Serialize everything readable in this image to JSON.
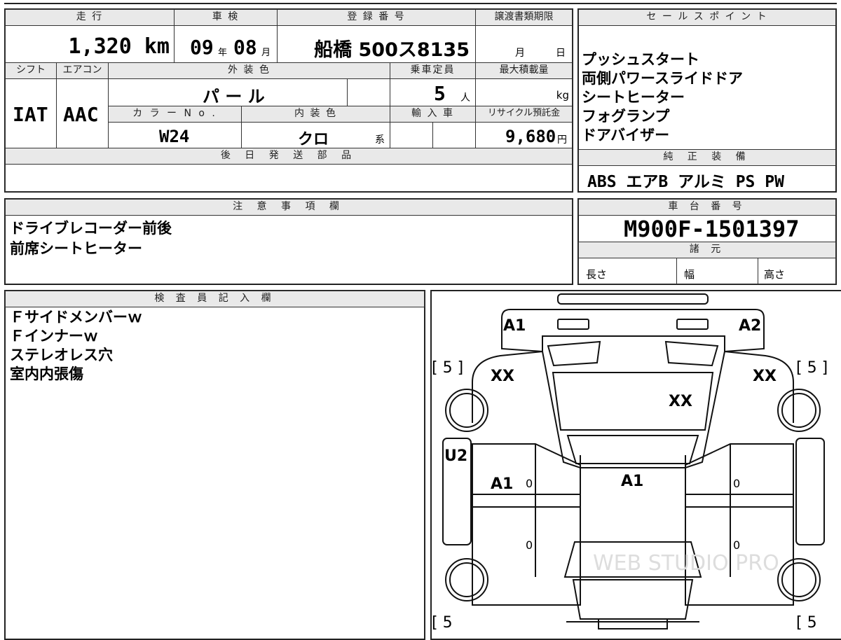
{
  "header": {
    "mileage_label": "走 行",
    "inspection_label": "車 検",
    "registration_label": "登 録 番 号",
    "transfer_deadline_label": "譲渡書類期限",
    "sales_points_label": "セ ー ル ス ポ イ ン ト"
  },
  "vehicle": {
    "mileage": "1,320 km",
    "inspection_year": "09",
    "year_unit": "年",
    "inspection_month": "08",
    "month_unit": "月",
    "registration": "船橋 500ス8135",
    "deadline_month_unit": "月",
    "deadline_day_unit": "日"
  },
  "row2": {
    "shift_label": "シフト",
    "aircon_label": "エアコン",
    "exterior_label": "外 装 色",
    "capacity_label": "乗車定員",
    "max_load_label": "最大積載量",
    "shift": "IAT",
    "aircon": "AAC",
    "exterior_color": "パ ー ル",
    "capacity": "5",
    "capacity_unit": "人",
    "load_unit": "kg",
    "color_no_label": "カ ラ ー N o .",
    "interior_label": "内 装 色",
    "import_label": "輸 入 車",
    "recycle_label": "リサイクル預託金",
    "color_no": "W24",
    "interior_color": "クロ",
    "interior_suffix": "系",
    "recycle_fee": "9,680",
    "yen_unit": "円"
  },
  "sales_points": [
    "プッシュスタート",
    "両側パワースライドドア",
    "シートヒーター",
    "フォグランプ",
    "ドアバイザー"
  ],
  "later_parts_label": "後 日 発 送 部 品",
  "standard_equipment_label": "純 正 装 備",
  "standard_equipment": "ABS エアB アルミ PS PW",
  "notes_label": "注 意 事 項 欄",
  "notes": [
    "ドライブレコーダー前後",
    "前席シートヒーター"
  ],
  "chassis_label": "車 台 番 号",
  "chassis_number": "M900F-1501397",
  "specs_label": "諸 元",
  "specs": {
    "length": "長さ",
    "width": "幅",
    "height": "高さ"
  },
  "inspector_label": "検 査 員 記 入 欄",
  "inspector_notes": [
    "Ｆサイドメンバーｗ",
    "Ｆインナーｗ",
    "ステレオレス穴",
    "室内内張傷"
  ],
  "diagram": {
    "front_left": "A1",
    "front_right": "A2",
    "tire_fl": "[ 5 ]",
    "tire_fr": "[ 5 ]",
    "tire_rl": "[ 5",
    "tire_rr": "[ 5",
    "fender_left": "XX",
    "fender_right": "XX",
    "hood": "XX",
    "side_left": "U2",
    "door_left": "A1",
    "roof": "A1",
    "zero_1": "0",
    "zero_2": "0",
    "zero_3": "0",
    "zero_4": "0",
    "watermark": "WEB STUDIO PRO"
  }
}
